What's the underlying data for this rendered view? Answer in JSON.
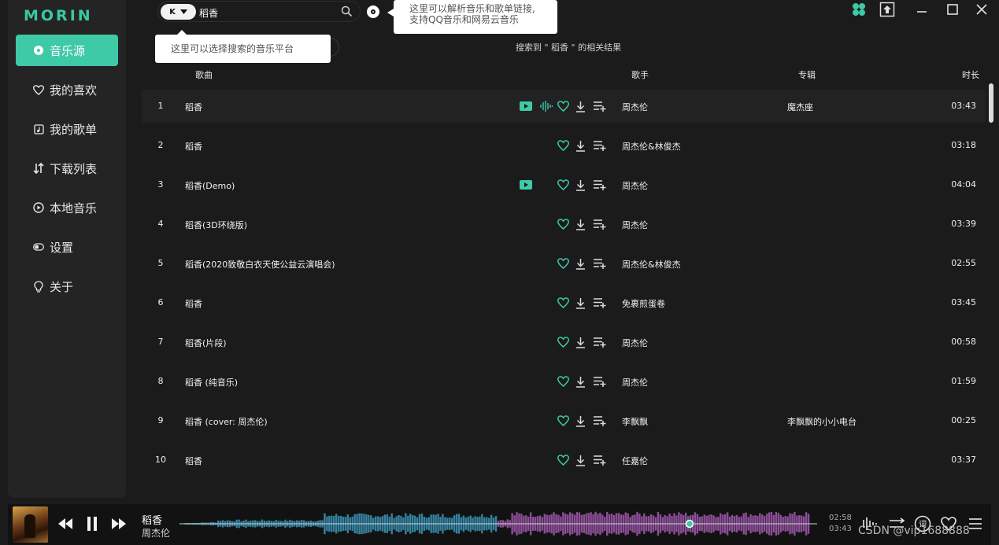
{
  "app": {
    "logo": "MORIN"
  },
  "colors": {
    "accent": "#3ec9a7",
    "bg": "#1b1b1b",
    "sidebar": "#242424",
    "waveform_blue": "#3b8fb0",
    "waveform_purple": "#9a56a6"
  },
  "sidebar": {
    "items": [
      {
        "label": "音乐源",
        "icon": "disc-icon",
        "active": true
      },
      {
        "label": "我的喜欢",
        "icon": "heart-icon",
        "active": false
      },
      {
        "label": "我的歌单",
        "icon": "playlist-icon",
        "active": false
      },
      {
        "label": "下载列表",
        "icon": "download-list-icon",
        "active": false
      },
      {
        "label": "本地音乐",
        "icon": "play-circle-icon",
        "active": false
      },
      {
        "label": "设置",
        "icon": "toggle-icon",
        "active": false
      },
      {
        "label": "关于",
        "icon": "bulb-icon",
        "active": false
      }
    ]
  },
  "search": {
    "platform": "K",
    "query": "稻香"
  },
  "tooltips": {
    "parse": [
      "这里可以解析音乐和歌单链接,",
      "支持QQ音乐和网易云音乐"
    ],
    "platform": "这里可以选择搜索的音乐平台"
  },
  "result_caption": "搜索到 \" 稻香 \" 的相关结果",
  "columns": {
    "song": "歌曲",
    "singer": "歌手",
    "album": "专辑",
    "duration": "时长"
  },
  "songs": [
    {
      "index": "1",
      "title": "稻香",
      "singer": "周杰伦",
      "album": "魔杰座",
      "duration": "03:43",
      "mv": true,
      "playing": true
    },
    {
      "index": "2",
      "title": "稻香",
      "singer": "周杰伦&林俊杰",
      "album": "",
      "duration": "03:18",
      "mv": false,
      "playing": false
    },
    {
      "index": "3",
      "title": "稻香(Demo)",
      "singer": "周杰伦",
      "album": "",
      "duration": "04:04",
      "mv": true,
      "playing": false
    },
    {
      "index": "4",
      "title": "稻香(3D环绕版)",
      "singer": "周杰伦",
      "album": "",
      "duration": "03:39",
      "mv": false,
      "playing": false
    },
    {
      "index": "5",
      "title": "稻香(2020致敬白衣天使公益云演唱会)",
      "singer": "周杰伦&林俊杰",
      "album": "",
      "duration": "02:55",
      "mv": false,
      "playing": false
    },
    {
      "index": "6",
      "title": "稻香",
      "singer": "免裹煎蛋卷",
      "album": "",
      "duration": "03:45",
      "mv": false,
      "playing": false
    },
    {
      "index": "7",
      "title": "稻香(片段)",
      "singer": "周杰伦",
      "album": "",
      "duration": "00:58",
      "mv": false,
      "playing": false
    },
    {
      "index": "8",
      "title": "稻香 (纯音乐)",
      "singer": "周杰伦",
      "album": "",
      "duration": "01:59",
      "mv": false,
      "playing": false
    },
    {
      "index": "9",
      "title": "稻香 (cover: 周杰伦)",
      "singer": "李飘飘",
      "album": "李飘飘的小小电台",
      "duration": "00:25",
      "mv": false,
      "playing": false
    },
    {
      "index": "10",
      "title": "稻香",
      "singer": "任嘉伦",
      "album": "",
      "duration": "03:37",
      "mv": false,
      "playing": false
    }
  ],
  "player": {
    "title": "稻香",
    "artist": "周杰伦",
    "current_time": "02:58",
    "total_time": "03:43",
    "progress": 0.8,
    "buttons": [
      "prev-icon",
      "pause-icon",
      "next-icon"
    ],
    "right_buttons": [
      "sound-effect-icon",
      "play-order-icon",
      "lyrics-icon",
      "like-icon",
      "queue-icon"
    ]
  },
  "watermark": "CSDN @vip1688888"
}
